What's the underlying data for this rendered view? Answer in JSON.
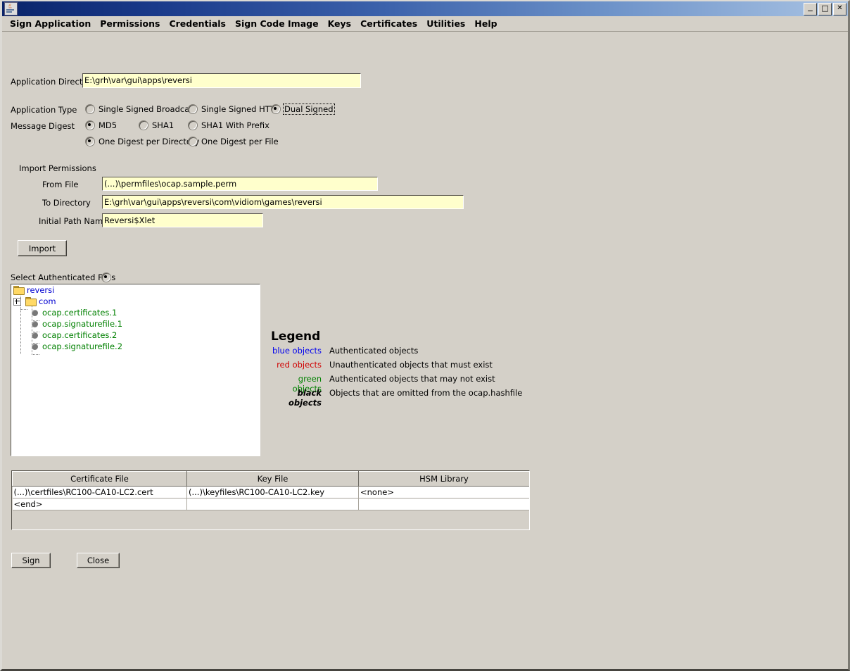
{
  "window": {
    "icon": "java-cup-icon",
    "title": "",
    "buttons": {
      "minimize": "_",
      "maximize": "□",
      "close": "✕"
    }
  },
  "menubar": {
    "items": [
      {
        "label": "Sign Application",
        "name": "menu-sign-application"
      },
      {
        "label": "Permissions",
        "name": "menu-permissions"
      },
      {
        "label": "Credentials",
        "name": "menu-credentials"
      },
      {
        "label": "Sign Code Image",
        "name": "menu-sign-code-image"
      },
      {
        "label": "Keys",
        "name": "menu-keys"
      },
      {
        "label": "Certificates",
        "name": "menu-certificates"
      },
      {
        "label": "Utilities",
        "name": "menu-utilities"
      },
      {
        "label": "Help",
        "name": "menu-help"
      }
    ]
  },
  "app_directory": {
    "label": "Application Directory",
    "value": "E:\\grh\\var\\gui\\apps\\reversi"
  },
  "application_type": {
    "label": "Application Type",
    "options": [
      {
        "label": "Single Signed Broadcast",
        "selected": false,
        "focused": false
      },
      {
        "label": "Single Signed HTTP",
        "selected": false,
        "focused": false
      },
      {
        "label": "Dual Signed",
        "selected": true,
        "focused": true
      }
    ]
  },
  "message_digest": {
    "label": "Message Digest",
    "options": [
      {
        "label": "MD5",
        "selected": true
      },
      {
        "label": "SHA1",
        "selected": false
      },
      {
        "label": "SHA1 With Prefix",
        "selected": false
      }
    ],
    "digest_scope": [
      {
        "label": "One Digest per Directory",
        "selected": true
      },
      {
        "label": "One Digest per File",
        "selected": false
      }
    ]
  },
  "import_permissions": {
    "title": "Import Permissions",
    "fields": [
      {
        "label": "From File",
        "value": "(...)\\permfiles\\ocap.sample.perm"
      },
      {
        "label": "To Directory",
        "value": "E:\\grh\\var\\gui\\apps\\reversi\\com\\vidiom\\games\\reversi"
      },
      {
        "label": "Initial Path Name",
        "value": "Reversi$Xlet"
      }
    ],
    "import_button": "Import"
  },
  "select_files": {
    "label": "Select Authenticated Files",
    "radio_selected": true,
    "tree": [
      {
        "label": "reversi",
        "type": "folder",
        "color": "blue",
        "depth": 0,
        "expander": false
      },
      {
        "label": "com",
        "type": "folder",
        "color": "blue",
        "depth": 0,
        "expander": true
      },
      {
        "label": "ocap.certificates.1",
        "type": "file",
        "color": "green",
        "depth": 1,
        "expander": false
      },
      {
        "label": "ocap.signaturefile.1",
        "type": "file",
        "color": "green",
        "depth": 1,
        "expander": false
      },
      {
        "label": "ocap.certificates.2",
        "type": "file",
        "color": "green",
        "depth": 1,
        "expander": false
      },
      {
        "label": "ocap.signaturefile.2",
        "type": "file",
        "color": "green",
        "depth": 1,
        "expander": false
      }
    ]
  },
  "legend": {
    "title": "Legend",
    "rows": [
      {
        "key": "blue objects",
        "style": "blue",
        "desc": "Authenticated objects"
      },
      {
        "key": "red objects",
        "style": "red",
        "desc": "Unauthenticated objects that must exist"
      },
      {
        "key": "green objects",
        "style": "green",
        "desc": "Authenticated objects that may not exist"
      },
      {
        "key": "black objects",
        "style": "black",
        "desc": "Objects that are omitted from the ocap.hashfile"
      }
    ]
  },
  "cert_table": {
    "columns": [
      "Certificate File",
      "Key File",
      "HSM Library"
    ],
    "rows": [
      [
        "(...)\\certfiles\\RC100-CA10-LC2.cert",
        "(...)\\keyfiles\\RC100-CA10-LC2.key",
        "<none>"
      ],
      [
        "<end>",
        "",
        ""
      ]
    ]
  },
  "actions": {
    "sign": "Sign",
    "close": "Close"
  },
  "colors": {
    "panel": "#d4d0c8",
    "field": "#ffffcc",
    "title_start": "#0a246a",
    "title_end": "#a9c3e3",
    "blue": "#0000ee",
    "red": "#d00000",
    "green": "#008000"
  }
}
